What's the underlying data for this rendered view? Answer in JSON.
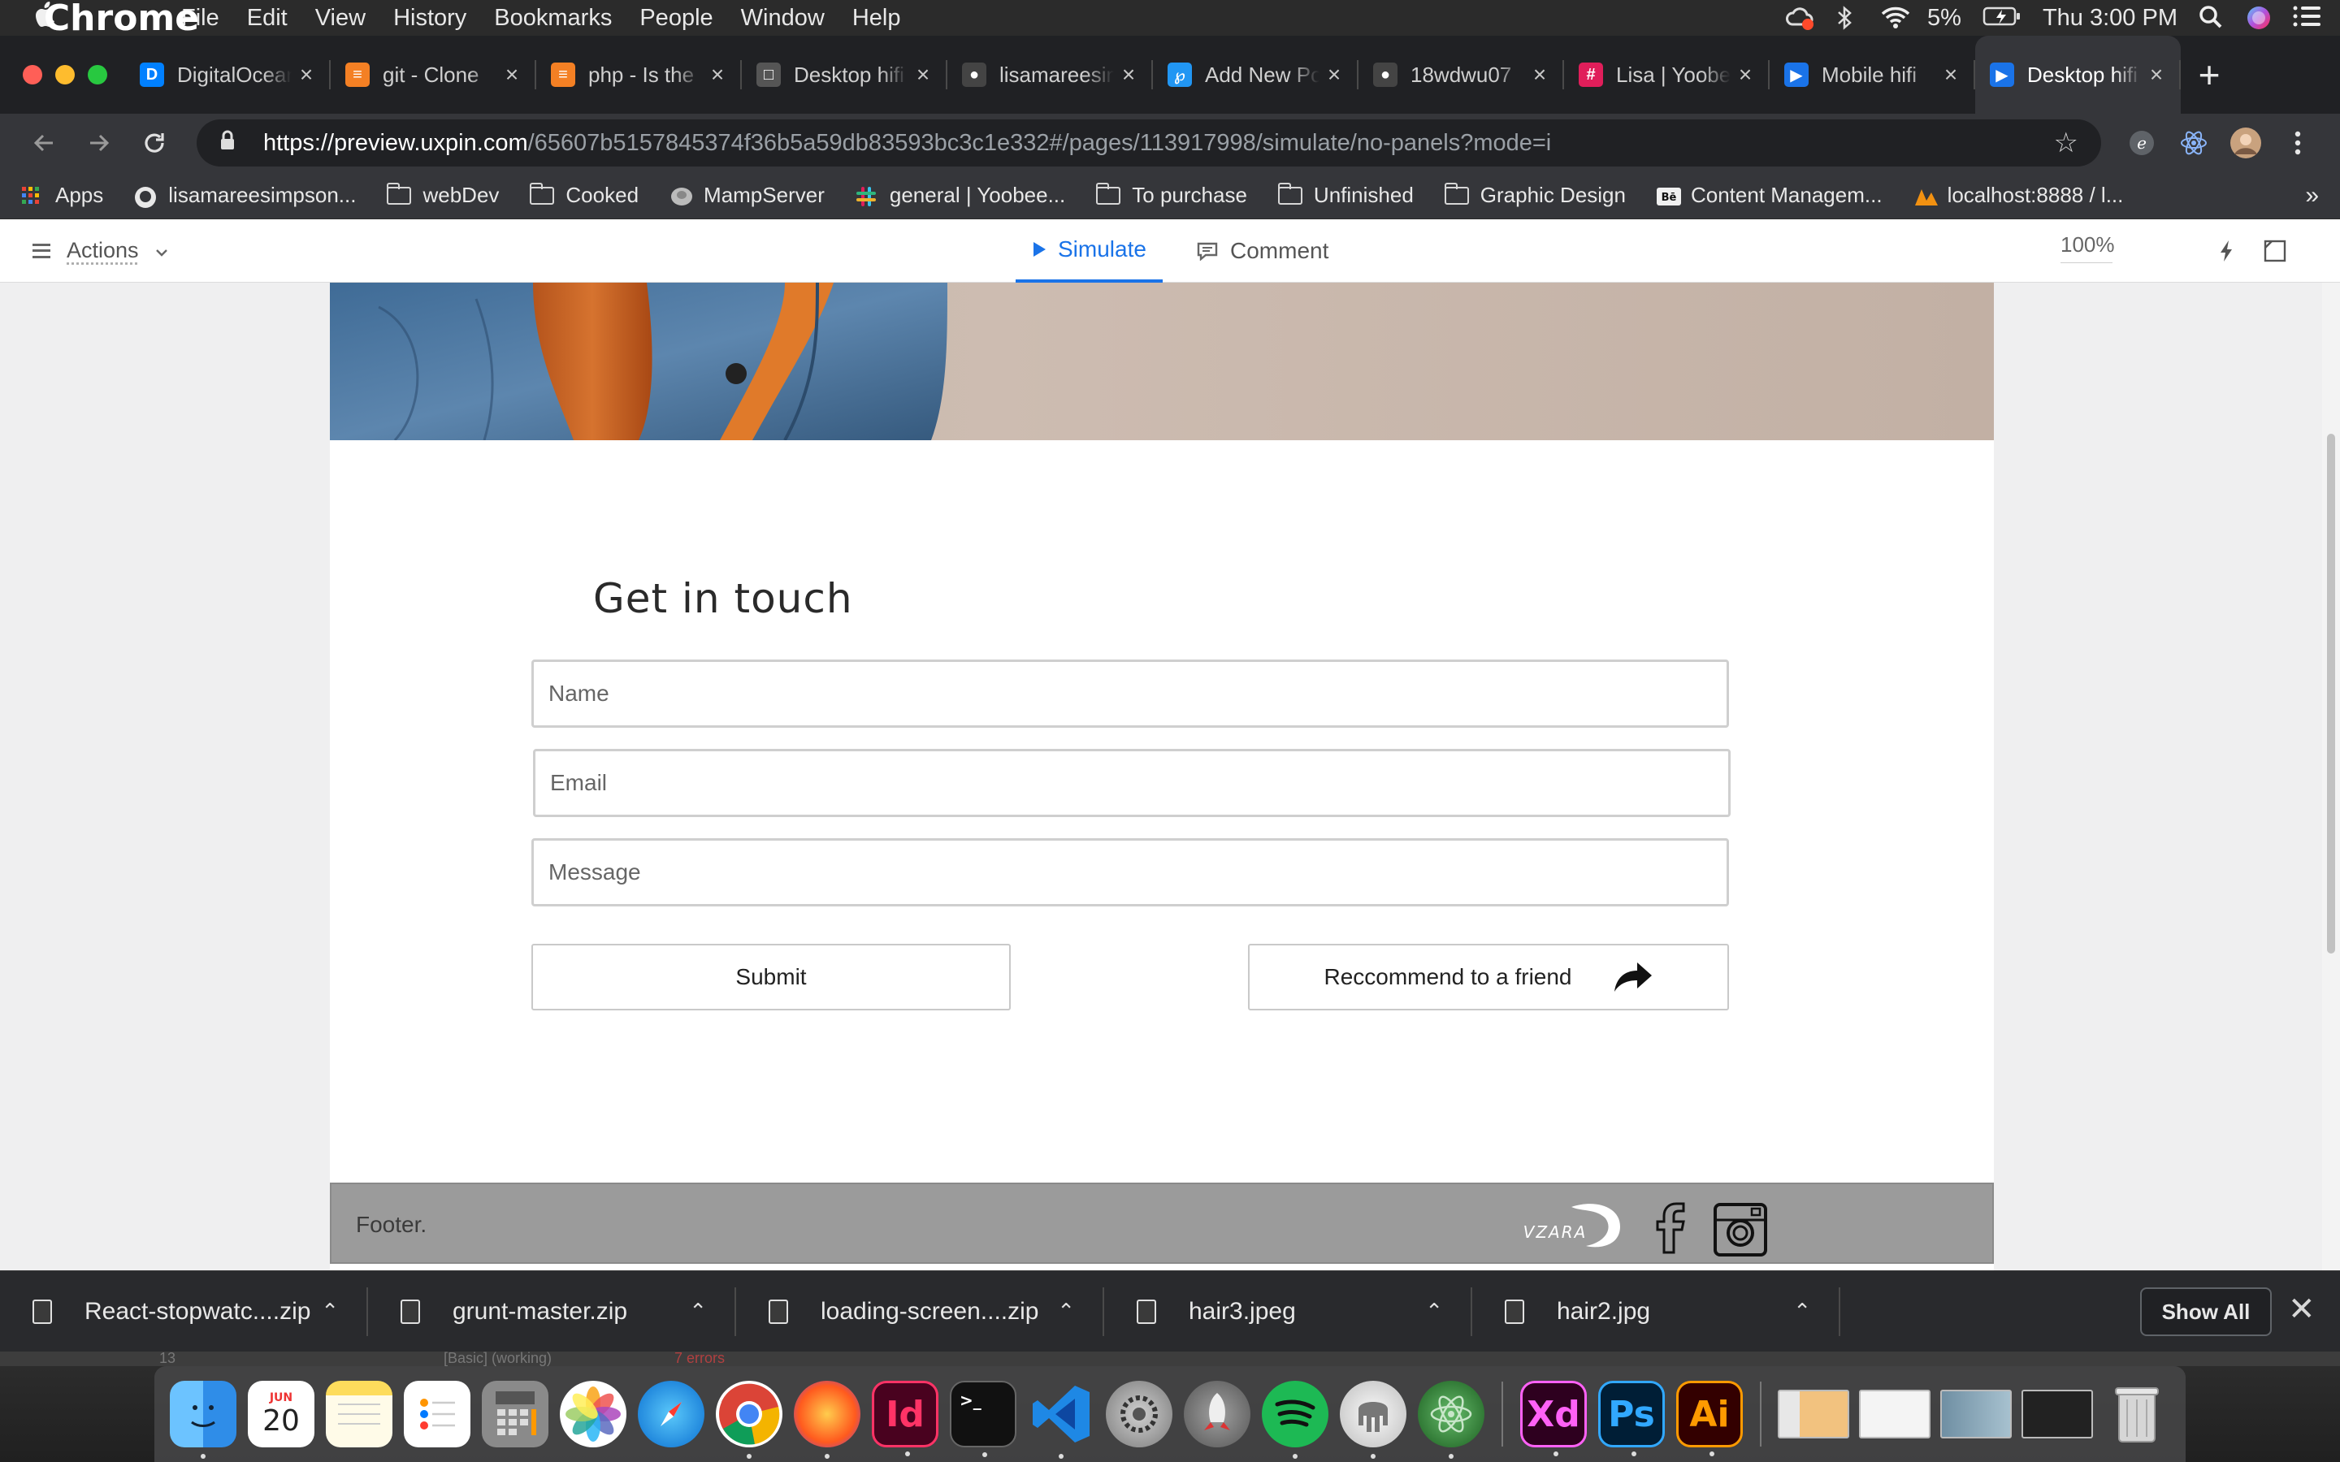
{
  "menubar": {
    "app_name": "Chrome",
    "items": [
      "File",
      "Edit",
      "View",
      "History",
      "Bookmarks",
      "People",
      "Window",
      "Help"
    ],
    "battery": "5%",
    "clock": "Thu 3:00 PM"
  },
  "tabs": [
    {
      "label": "DigitalOcean",
      "fav": "D",
      "color": "#0080ff"
    },
    {
      "label": "git - Clone",
      "fav": "≡",
      "color": "#f48024"
    },
    {
      "label": "php - Is the",
      "fav": "≡",
      "color": "#f48024"
    },
    {
      "label": "Desktop hifi",
      "fav": "□",
      "color": "#555"
    },
    {
      "label": "lisamareesimpson",
      "fav": "●",
      "color": "#444"
    },
    {
      "label": "Add New Post",
      "fav": "℘",
      "color": "#2196f3"
    },
    {
      "label": "18wdwu07",
      "fav": "●",
      "color": "#444"
    },
    {
      "label": "Lisa | Yoobee",
      "fav": "#",
      "color": "#e01e5a"
    },
    {
      "label": "Mobile hifi",
      "fav": "▶",
      "color": "#1a73e8"
    },
    {
      "label": "Desktop hifi",
      "fav": "▶",
      "color": "#1a73e8"
    }
  ],
  "omnibox": {
    "url_host": "https://preview.uxpin.com",
    "url_rest": "/65607b5157845374f36b5a59db83593bc3c1e332#/pages/113917998/simulate/no-panels?mode=i"
  },
  "bookmarks": [
    {
      "label": "Apps",
      "type": "apps"
    },
    {
      "label": "lisamareesimpson...",
      "type": "github"
    },
    {
      "label": "webDev",
      "type": "folder"
    },
    {
      "label": "Cooked",
      "type": "folder"
    },
    {
      "label": "MampServer",
      "type": "elephant"
    },
    {
      "label": "general | Yoobee...",
      "type": "slack"
    },
    {
      "label": "To purchase",
      "type": "folder"
    },
    {
      "label": "Unfinished",
      "type": "folder"
    },
    {
      "label": "Graphic Design",
      "type": "folder"
    },
    {
      "label": "Content Managem...",
      "type": "behance"
    },
    {
      "label": "localhost:8888 / l...",
      "type": "pma"
    }
  ],
  "uxpin": {
    "actions_label": "Actions",
    "simulate_label": "Simulate",
    "comment_label": "Comment",
    "zoom": "100%"
  },
  "page": {
    "form_title": "Get in touch",
    "name_placeholder": "Name",
    "email_placeholder": "Email",
    "message_placeholder": "Message",
    "submit_label": "Submit",
    "recommend_label": "Reccommend to a friend",
    "footer_text": "Footer.",
    "logo_text": "VZARA"
  },
  "downloads": [
    {
      "name": "React-stopwatc....zip"
    },
    {
      "name": "grunt-master.zip"
    },
    {
      "name": "loading-screen....zip"
    },
    {
      "name": "hair3.jpeg"
    },
    {
      "name": "hair2.jpg"
    }
  ],
  "shelf": {
    "show_all": "Show All"
  },
  "background_app": {
    "number": "13",
    "status": "[Basic] (working)",
    "errors": "7 errors"
  },
  "dock": {
    "calendar_month": "JUN",
    "calendar_day": "20",
    "apps": [
      "Finder",
      "Calendar",
      "Notes",
      "Reminders",
      "Calculator",
      "Photos",
      "Safari",
      "Chrome",
      "Firefox",
      "InDesign",
      "Terminal",
      "VS Code",
      "System Preferences",
      "Launchpad",
      "Spotify",
      "Sequel Pro",
      "Atom",
      "Adobe XD",
      "Photoshop",
      "Illustrator"
    ],
    "xd": "Xd",
    "ps": "Ps",
    "ai": "Ai",
    "id": "Id"
  }
}
